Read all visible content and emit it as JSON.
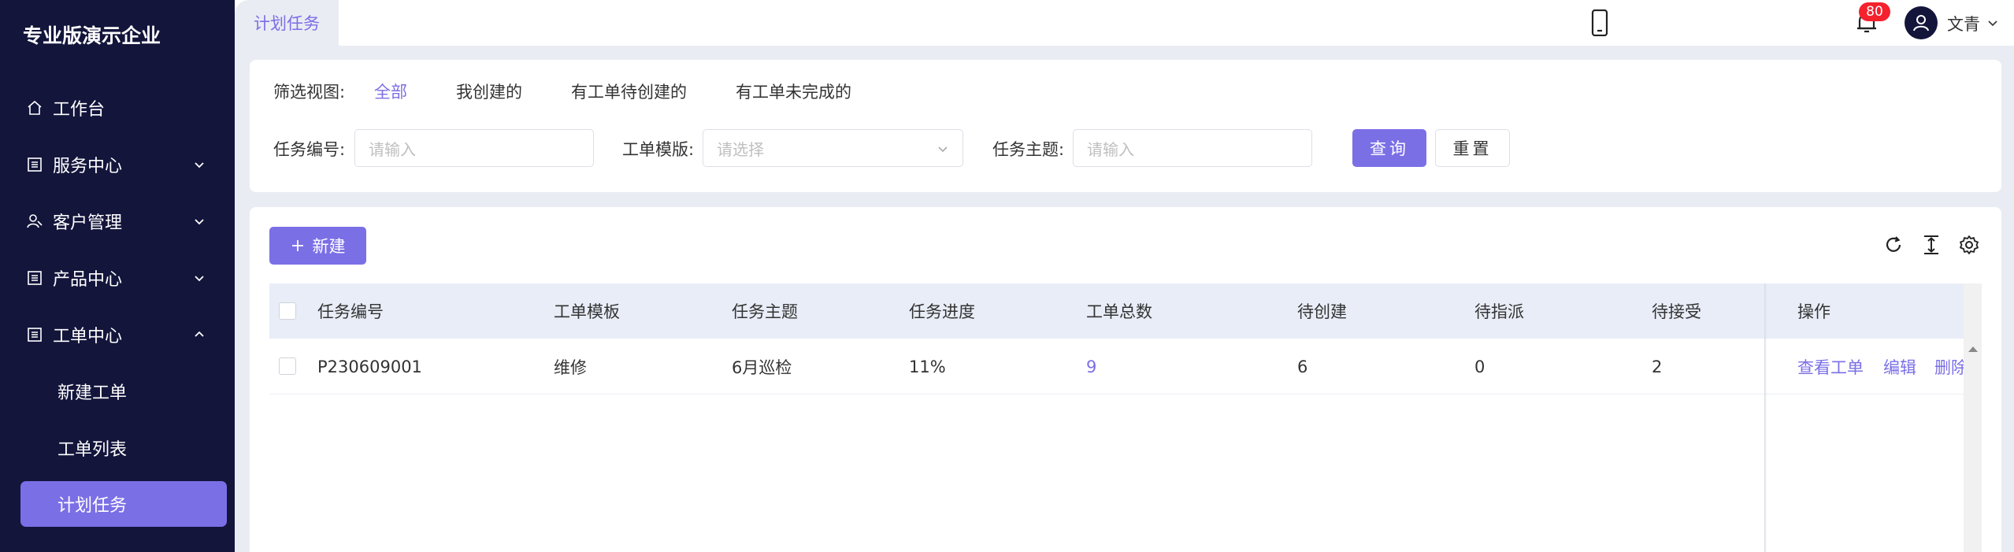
{
  "sidebar": {
    "brand": "专业版演示企业",
    "menu": [
      {
        "label": "工作台",
        "icon": "home-icon"
      },
      {
        "label": "服务中心",
        "icon": "list-icon"
      },
      {
        "label": "客户管理",
        "icon": "users-icon"
      },
      {
        "label": "产品中心",
        "icon": "list-icon"
      },
      {
        "label": "工单中心",
        "icon": "list-icon"
      }
    ],
    "submenu": [
      {
        "label": "新建工单"
      },
      {
        "label": "工单列表"
      },
      {
        "label": "计划任务"
      }
    ]
  },
  "topbar": {
    "tab_label": "计划任务",
    "notification_count": "80",
    "username": "文青"
  },
  "filter": {
    "view_label": "筛选视图:",
    "views": [
      "全部",
      "我创建的",
      "有工单待创建的",
      "有工单未完成的"
    ],
    "task_no_label": "任务编号:",
    "task_no_placeholder": "请输入",
    "template_label": "工单模版:",
    "template_placeholder": "请选择",
    "subject_label": "任务主题:",
    "subject_placeholder": "请输入",
    "query_label": "查询",
    "reset_label": "重置"
  },
  "table": {
    "new_label": "新建",
    "columns": [
      "任务编号",
      "工单模板",
      "任务主题",
      "任务进度",
      "工单总数",
      "待创建",
      "待指派",
      "待接受",
      "操作"
    ],
    "rows": [
      {
        "task_no": "P230609001",
        "template": "维修",
        "subject": "6月巡检",
        "progress": "11%",
        "total": "9",
        "pending_create": "6",
        "pending_assign": "0",
        "pending_accept": "2",
        "actions": [
          "查看工单",
          "编辑",
          "删除"
        ]
      }
    ]
  },
  "colors": {
    "primary": "#7b6fe6",
    "sidebar_bg": "#13153b",
    "badge": "#f5222d"
  }
}
